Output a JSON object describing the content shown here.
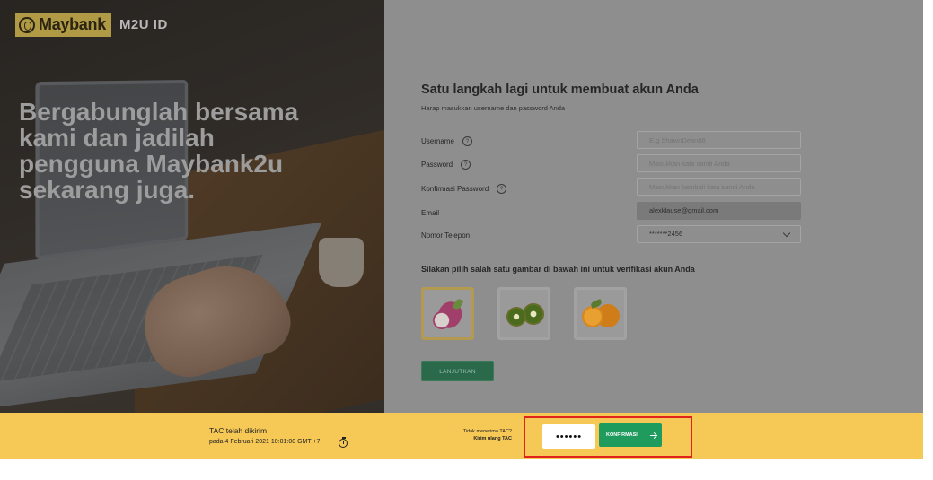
{
  "brand": {
    "logo_text": "Maybank",
    "app_name": "M2U ID"
  },
  "hero": {
    "headline": "Bergabunglah bersama kami dan jadilah pengguna Maybank2u sekarang juga."
  },
  "form": {
    "title": "Satu langkah lagi untuk membuat akun Anda",
    "subtitle": "Harap masukkan username dan password Anda",
    "fields": {
      "username": {
        "label": "Username",
        "placeholder": "E.g ShawnDean88",
        "value": ""
      },
      "password": {
        "label": "Password",
        "placeholder": "Masukkan kata sandi Anda",
        "value": ""
      },
      "confirm_password": {
        "label": "Konfirmasi Password",
        "placeholder": "Masukkan kembali kata sandi Anda",
        "value": ""
      },
      "email": {
        "label": "Email",
        "value": "alexklause@gmail.com"
      },
      "phone": {
        "label": "Nomor Telepon",
        "value": "*******2456"
      }
    },
    "verify_label": "Silakan pilih salah satu gambar di bawah ini untuk verifikasi akun Anda",
    "image_options": [
      {
        "icon": "dragonfruit-icon",
        "selected": true
      },
      {
        "icon": "kiwi-icon",
        "selected": false
      },
      {
        "icon": "orange-icon",
        "selected": false
      }
    ],
    "continue_label": "LANJUTKAN"
  },
  "tac": {
    "title": "TAC telah dikirim",
    "sent_at": "pada 4 Februari 2021 10:01:00 GMT +7",
    "not_received": "Tidak menerima TAC?",
    "resend": "Kirim ulang TAC",
    "input_value": "••••••",
    "confirm_label": "KONFIRMASI"
  },
  "colors": {
    "tac_bar": "#f6c957",
    "confirm_button": "#1f9b5e",
    "highlight": "#e2231a",
    "brand_gold": "#b09a45"
  }
}
